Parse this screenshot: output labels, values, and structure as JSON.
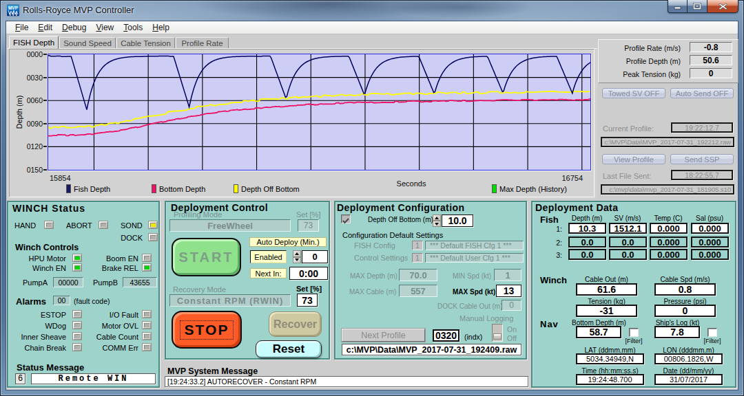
{
  "window": {
    "title": "Rolls-Royce MVP Controller",
    "icon": "mvp-logo",
    "buttons": {
      "minimize": "minimize",
      "maximize": "maximize",
      "close": "close"
    }
  },
  "menu": {
    "items": [
      "File",
      "Edit",
      "Debug",
      "View",
      "Tools",
      "Help"
    ]
  },
  "tabs": {
    "active": "FISH Depth",
    "items": [
      "FISH Depth",
      "Sound Speed",
      "Cable Tension",
      "Profile Rate"
    ]
  },
  "chart_data": {
    "type": "line",
    "xlabel": "Seconds",
    "ylabel": "Depth (m)",
    "x_range": [
      15854,
      16754
    ],
    "y_range": [
      0,
      150
    ],
    "y_inverted": true,
    "x_tick_labels": [
      "15854",
      "16754"
    ],
    "y_ticks": {
      "values": [
        0,
        30,
        60,
        90,
        120,
        150
      ],
      "labels": [
        "0000",
        "0030",
        "0060",
        "0090",
        "0120",
        "0150"
      ]
    },
    "grid": {
      "x_step_seconds": 90,
      "y_step_m": 30,
      "color": "#000000"
    },
    "plot_bg": "#cdcdf5",
    "frame_color": "#2b2be4",
    "series": [
      {
        "name": "Fish Depth",
        "color": "#000060",
        "baseline_depth_m": 2.3,
        "dips": [
          {
            "t": 15918,
            "depth": 72
          },
          {
            "t": 16088,
            "depth": 68.5
          },
          {
            "t": 16249,
            "depth": 58
          },
          {
            "t": 16379,
            "depth": 53
          },
          {
            "t": 16495,
            "depth": 51.5
          },
          {
            "t": 16609,
            "depth": 50.5
          },
          {
            "t": 16724,
            "depth": 50.6
          }
        ]
      },
      {
        "name": "Bottom Depth",
        "color": "#ee1166",
        "points": [
          [
            15854,
            105.2
          ],
          [
            15891,
            105.0
          ],
          [
            15932,
            103.5
          ],
          [
            15978,
            98.5
          ],
          [
            16022,
            91.0
          ],
          [
            16066,
            84.0
          ],
          [
            16111,
            78.0
          ],
          [
            16155,
            73.5
          ],
          [
            16200,
            70.0
          ],
          [
            16244,
            67.5
          ],
          [
            16289,
            65.3
          ],
          [
            16347,
            63.2
          ],
          [
            16404,
            62.1
          ],
          [
            16462,
            61.3
          ],
          [
            16519,
            60.5
          ],
          [
            16576,
            60.1
          ],
          [
            16633,
            59.6
          ],
          [
            16690,
            59.3
          ],
          [
            16754,
            58.9
          ]
        ]
      },
      {
        "name": "Depth Off Bottom",
        "color": "#ffff00",
        "offset_from_bottom_m": -10.3
      },
      {
        "name": "Max Depth (History)",
        "color": "#00dd00",
        "visible": false
      }
    ],
    "legend": [
      {
        "label": "Fish Depth",
        "color": "#1a1a60"
      },
      {
        "label": "Bottom Depth",
        "color": "#ee1166"
      },
      {
        "label": "Depth Off Bottom",
        "color": "#ffff00"
      },
      {
        "label": "Max Depth (History)",
        "color": "#00dd00"
      }
    ]
  },
  "profile_panel": {
    "rows": [
      {
        "label": "Profile Rate (m/s)",
        "value": "-0.8"
      },
      {
        "label": "Profile Depth (m)",
        "value": "50.6"
      },
      {
        "label": "Peak Tension (kg)",
        "value": "0"
      }
    ],
    "towed_sv_button": "Towed SV OFF",
    "auto_send_button": "Auto Send  OFF",
    "current_profile": {
      "label": "Current Profile:",
      "value": "19:22:12.7",
      "file": "c:\\MVP\\Data\\MVP_2017-07-31_192212.raw"
    },
    "view_profile_button": "View Profile",
    "send_ssp_button": "Send SSP",
    "last_file_sent": {
      "label": "Last File Sent:",
      "value": "18:22:55.7",
      "file": "c:\\mvp\\data\\mvp_2017-07-31_181905.s10"
    }
  },
  "winch_status": {
    "title": "WINCH Status",
    "indicators": [
      {
        "label": "HAND",
        "state": "off"
      },
      {
        "label": "ABORT",
        "state": "off"
      },
      {
        "label": "SOND",
        "state": "yellow"
      },
      {
        "label": "DOCK",
        "state": "off"
      }
    ],
    "winch_controls": {
      "title": "Winch Controls",
      "items": [
        {
          "label": "HPU Motor",
          "state": "green"
        },
        {
          "label": "Boom EN",
          "state": "off"
        },
        {
          "label": "Winch EN",
          "state": "green"
        },
        {
          "label": "Brake REL",
          "state": "green"
        }
      ]
    },
    "pump_a": {
      "label": "PumpA",
      "value": "00000"
    },
    "pump_b": {
      "label": "PumpB",
      "value": "43655"
    },
    "alarms": {
      "title": "Alarms",
      "code": "00",
      "code_note": "(fault code)",
      "items": [
        {
          "label": "ESTOP",
          "state": "off"
        },
        {
          "label": "I/O Fault",
          "state": "off"
        },
        {
          "label": "WDog",
          "state": "off"
        },
        {
          "label": "Motor OVL",
          "state": "off"
        },
        {
          "label": "Inner Sheave",
          "state": "off"
        },
        {
          "label": "Cable Count",
          "state": "off"
        },
        {
          "label": "Chain Break",
          "state": "off"
        },
        {
          "label": "COMM Err",
          "state": "off"
        }
      ]
    },
    "status_message": {
      "title": "Status Message",
      "code": "6",
      "text": "Remote WIN"
    }
  },
  "deployment_control": {
    "title": "Deployment Control",
    "profiling_mode": {
      "label": "Profiling Mode",
      "value": "FreeWheel",
      "set_label": "Set [%]",
      "set_value": "73"
    },
    "start_button": "START",
    "auto_deploy_label": "Auto Deploy (Min.)",
    "enabled_label": "Enabled",
    "enabled_value": "0",
    "next_in_label": "Next In:",
    "next_in_value": "0:00",
    "recovery_mode": {
      "label": "Recovery Mode",
      "value": "Constant RPM (RWIN)",
      "set_label": "Set [%]",
      "set_value": "73"
    },
    "stop_button": "STOP",
    "recover_button": "Recover",
    "reset_button": "Reset"
  },
  "deployment_configuration": {
    "title": "Deployment Configuration",
    "depth_off_bottom": {
      "label": "Depth Off Bottom (m)",
      "value": "10.0",
      "checked": true
    },
    "defaults_title": "Configuration Default Settings",
    "fish_config": {
      "label": "FISH Config",
      "index": "1",
      "value": "*** Default FISH Cfg 1 ***"
    },
    "control_settings": {
      "label": "Control Settings",
      "index": "1",
      "value": "*** Default User Cfg 1 ***"
    },
    "max_depth": {
      "label": "MAX Depth (m)",
      "value": "70.0"
    },
    "min_spd": {
      "label": "MIN Spd (kt)",
      "value": "1"
    },
    "max_cable": {
      "label": "MAX Cable (m)",
      "value": "557"
    },
    "max_spd": {
      "label": "MAX Spd (kt)",
      "value": "13"
    },
    "dock_cable_out": {
      "label": "DOCK Cable Out (m)",
      "value": "0"
    },
    "manual_logging": {
      "label": "Manual Logging",
      "on_label": "On",
      "off_label": "Off",
      "state": "off"
    },
    "next_profile": {
      "button": "Next Profile",
      "value": "0320",
      "note": "(indx)"
    },
    "file": "c:\\MVP\\Data\\MVP_2017-07-31_192409.raw"
  },
  "deployment_data": {
    "title": "Deployment Data",
    "fish": {
      "label": "Fish",
      "headers": [
        "Depth (m)",
        "SV (m/s)",
        "Temp (C)",
        "Sal (psu)"
      ],
      "rows": [
        {
          "label": "1:",
          "values": [
            "10.3",
            "1512.1",
            "0.000",
            "0.000"
          ],
          "active": true
        },
        {
          "label": "2:",
          "values": [
            "0.0",
            "0.0",
            "0.000",
            "0.000"
          ],
          "active": false
        },
        {
          "label": "3:",
          "values": [
            "0.0",
            "0.0",
            "0.000",
            "0.000"
          ],
          "active": false
        }
      ]
    },
    "winch": {
      "label": "Winch",
      "cable_out": {
        "label": "Cable Out (m)",
        "value": "61.6"
      },
      "cable_spd": {
        "label": "Cable Spd (m/s)",
        "value": "0.8"
      },
      "tension": {
        "label": "Tension (kg)",
        "value": "-31"
      },
      "pressure": {
        "label": "Pressure (psi)",
        "value": "0"
      }
    },
    "nav": {
      "label": "Nav",
      "bottom_depth": {
        "label": "Bottom Depth (m)",
        "value": "58.7",
        "filter": "[Filter]"
      },
      "ships_log": {
        "label": "Ship's Log (kt)",
        "value": "7.8",
        "filter": "[Filter]"
      },
      "lat": {
        "label": "LAT (ddmm.mm)",
        "value": "5034.34949,N"
      },
      "lon": {
        "label": "LON (dddmm.m)",
        "value": "00806.1826,W"
      },
      "time": {
        "label": "Time (hh:mm:ss.s)",
        "value": "19:24:48.700"
      },
      "date": {
        "label": "Date (dd/mm/yy)",
        "value": "31/07/2017"
      }
    }
  },
  "system_message": {
    "title": "MVP System Message",
    "text": "[19:24:33.2] AUTORECOVER - Constant RPM"
  }
}
